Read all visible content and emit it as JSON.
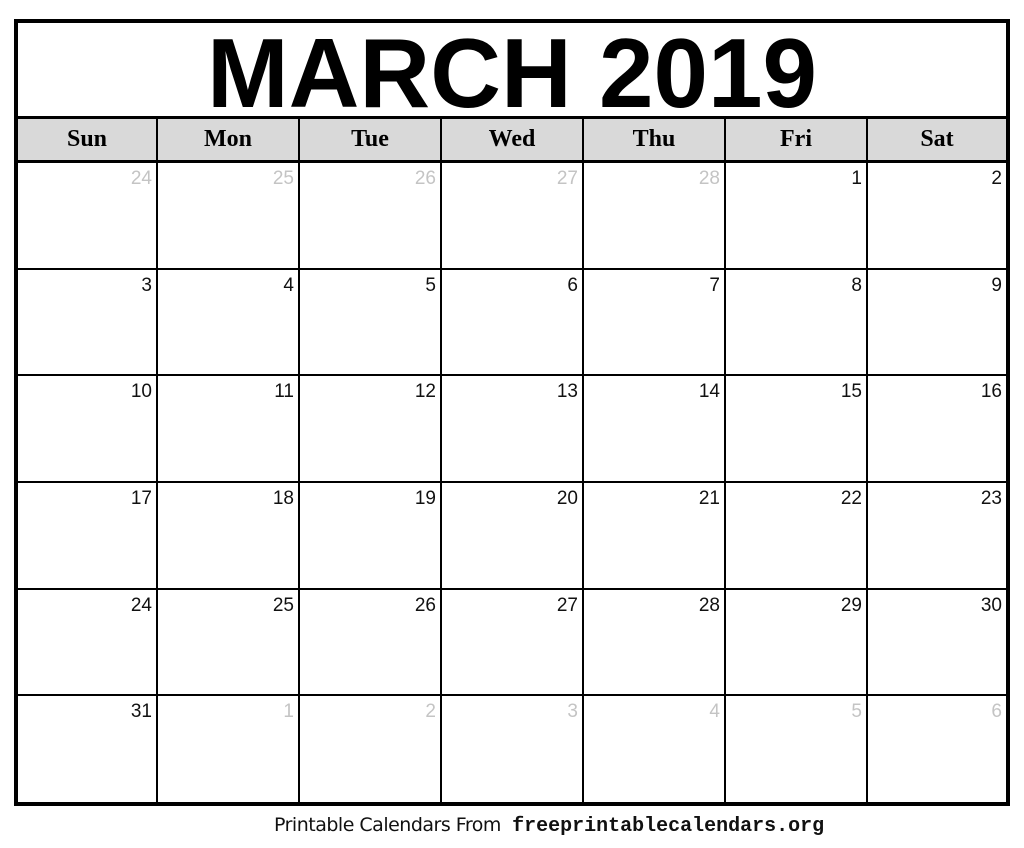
{
  "title": "MARCH 2019",
  "weekdays": [
    "Sun",
    "Mon",
    "Tue",
    "Wed",
    "Thu",
    "Fri",
    "Sat"
  ],
  "weeks": [
    [
      {
        "day": "24",
        "current": false
      },
      {
        "day": "25",
        "current": false
      },
      {
        "day": "26",
        "current": false
      },
      {
        "day": "27",
        "current": false
      },
      {
        "day": "28",
        "current": false
      },
      {
        "day": "1",
        "current": true
      },
      {
        "day": "2",
        "current": true
      }
    ],
    [
      {
        "day": "3",
        "current": true
      },
      {
        "day": "4",
        "current": true
      },
      {
        "day": "5",
        "current": true
      },
      {
        "day": "6",
        "current": true
      },
      {
        "day": "7",
        "current": true
      },
      {
        "day": "8",
        "current": true
      },
      {
        "day": "9",
        "current": true
      }
    ],
    [
      {
        "day": "10",
        "current": true
      },
      {
        "day": "11",
        "current": true
      },
      {
        "day": "12",
        "current": true
      },
      {
        "day": "13",
        "current": true
      },
      {
        "day": "14",
        "current": true
      },
      {
        "day": "15",
        "current": true
      },
      {
        "day": "16",
        "current": true
      }
    ],
    [
      {
        "day": "17",
        "current": true
      },
      {
        "day": "18",
        "current": true
      },
      {
        "day": "19",
        "current": true
      },
      {
        "day": "20",
        "current": true
      },
      {
        "day": "21",
        "current": true
      },
      {
        "day": "22",
        "current": true
      },
      {
        "day": "23",
        "current": true
      }
    ],
    [
      {
        "day": "24",
        "current": true
      },
      {
        "day": "25",
        "current": true
      },
      {
        "day": "26",
        "current": true
      },
      {
        "day": "27",
        "current": true
      },
      {
        "day": "28",
        "current": true
      },
      {
        "day": "29",
        "current": true
      },
      {
        "day": "30",
        "current": true
      }
    ],
    [
      {
        "day": "31",
        "current": true
      },
      {
        "day": "1",
        "current": false
      },
      {
        "day": "2",
        "current": false
      },
      {
        "day": "3",
        "current": false
      },
      {
        "day": "4",
        "current": false
      },
      {
        "day": "5",
        "current": false
      },
      {
        "day": "6",
        "current": false
      }
    ]
  ],
  "colors": {
    "header_bg": "#d9d9d9",
    "other_month_text": "#c4c4c4",
    "border": "#000000"
  },
  "footer": {
    "label": "Printable Calendars From",
    "url": "freeprintablecalendars.org"
  }
}
